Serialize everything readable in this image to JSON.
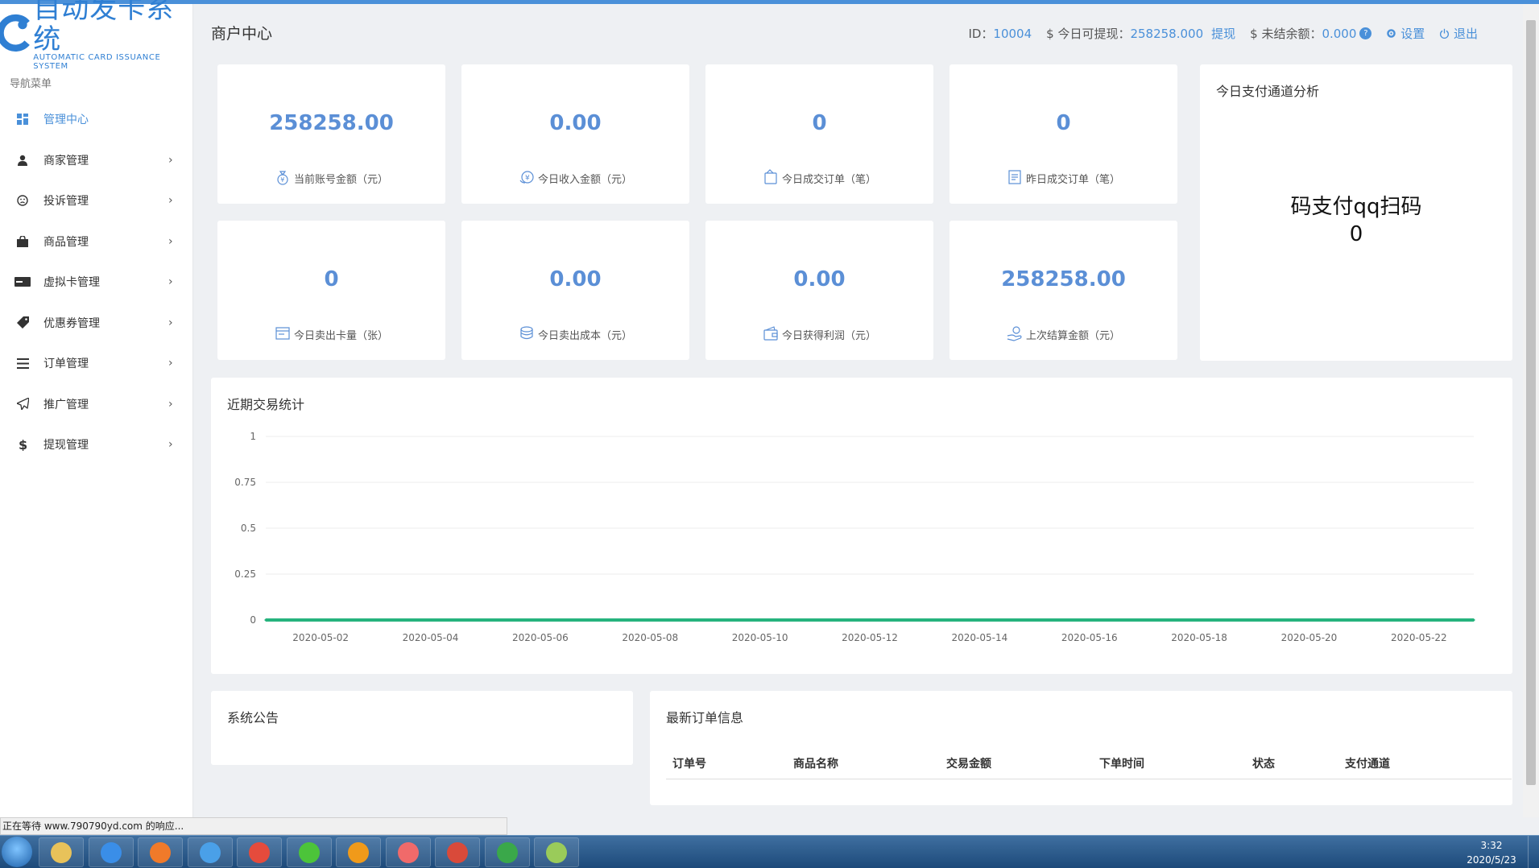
{
  "logo": {
    "cn": "自动发卡系统",
    "en": "AUTOMATIC CARD ISSUANCE SYSTEM"
  },
  "nav": {
    "title": "导航菜单",
    "items": [
      {
        "label": "管理中心",
        "icon": "dashboard-icon",
        "active": true
      },
      {
        "label": "商家管理",
        "icon": "user-icon"
      },
      {
        "label": "投诉管理",
        "icon": "sad-face-icon"
      },
      {
        "label": "商品管理",
        "icon": "shopping-bag-icon"
      },
      {
        "label": "虚拟卡管理",
        "icon": "card-icon"
      },
      {
        "label": "优惠券管理",
        "icon": "tag-icon"
      },
      {
        "label": "订单管理",
        "icon": "list-icon"
      },
      {
        "label": "推广管理",
        "icon": "paper-plane-icon"
      },
      {
        "label": "提现管理",
        "icon": "dollar-icon"
      }
    ]
  },
  "header": {
    "title": "商户中心",
    "id_label": "ID：",
    "id_value": "10004",
    "withdraw_label": "$ 今日可提现：",
    "withdraw_value": "258258.000",
    "withdraw_link": "提现",
    "unsettled_label": "$ 未结余额：",
    "unsettled_value": "0.000",
    "help_glyph": "?",
    "settings_label": "设置",
    "logout_label": "退出"
  },
  "stats": [
    {
      "value": "258258.00",
      "label": "当前账号金额（元）",
      "icon": "money-bag-icon"
    },
    {
      "value": "0.00",
      "label": "今日收入金额（元）",
      "icon": "yen-coin-icon"
    },
    {
      "value": "0",
      "label": "今日成交订单（笔）",
      "icon": "wallet-icon"
    },
    {
      "value": "0",
      "label": "昨日成交订单（笔）",
      "icon": "document-icon"
    },
    {
      "value": "0",
      "label": "今日卖出卡量（张）",
      "icon": "card-icon"
    },
    {
      "value": "0.00",
      "label": "今日卖出成本（元）",
      "icon": "coins-icon"
    },
    {
      "value": "0.00",
      "label": "今日获得利润（元）",
      "icon": "purse-icon"
    },
    {
      "value": "258258.00",
      "label": "上次结算金额（元）",
      "icon": "hand-coin-icon"
    }
  ],
  "pie_panel": {
    "title": "今日支付通道分析",
    "line1": "码支付qq扫码",
    "line2": "0"
  },
  "chart_panel": {
    "title": "近期交易统计"
  },
  "chart_data": {
    "type": "line",
    "title": "近期交易统计",
    "x": [
      "2020-05-01",
      "2020-05-02",
      "2020-05-03",
      "2020-05-04",
      "2020-05-05",
      "2020-05-06",
      "2020-05-07",
      "2020-05-08",
      "2020-05-09",
      "2020-05-10",
      "2020-05-11",
      "2020-05-12",
      "2020-05-13",
      "2020-05-14",
      "2020-05-15",
      "2020-05-16",
      "2020-05-17",
      "2020-05-18",
      "2020-05-19",
      "2020-05-20",
      "2020-05-21",
      "2020-05-22",
      "2020-05-23"
    ],
    "xtick_labels": [
      "2020-05-02",
      "2020-05-04",
      "2020-05-06",
      "2020-05-08",
      "2020-05-10",
      "2020-05-12",
      "2020-05-14",
      "2020-05-16",
      "2020-05-18",
      "2020-05-20",
      "2020-05-22"
    ],
    "series": [
      {
        "values": [
          0,
          0,
          0,
          0,
          0,
          0,
          0,
          0,
          0,
          0,
          0,
          0,
          0,
          0,
          0,
          0,
          0,
          0,
          0,
          0,
          0,
          0,
          0
        ],
        "color": "#26b37d"
      }
    ],
    "ylim": [
      0,
      1
    ],
    "yticks": [
      "0",
      "0.25",
      "0.5",
      "0.75",
      "1"
    ],
    "grid": true
  },
  "notice_panel": {
    "title": "系统公告"
  },
  "orders_panel": {
    "title": "最新订单信息",
    "columns": [
      "订单号",
      "商品名称",
      "交易金额",
      "下单时间",
      "状态",
      "支付通道"
    ]
  },
  "statusbar": {
    "text": "正在等待 www.790790yd.com 的响应..."
  },
  "taskbar": {
    "apps": [
      "file-explorer-icon",
      "ie-icon",
      "firefox-icon",
      "baidu-netdisk-icon",
      "chrome-icon",
      "media-player-icon",
      "uc-browser-icon",
      "360-browser-icon",
      "snail-app-icon",
      "leaf-app-icon",
      "notepad-chart-icon"
    ],
    "time": "3:32",
    "date": "2020/5/23"
  },
  "colors": {
    "accent": "#4a90d9",
    "stat_value": "#5b8fd6",
    "chart_line": "#26b37d"
  }
}
